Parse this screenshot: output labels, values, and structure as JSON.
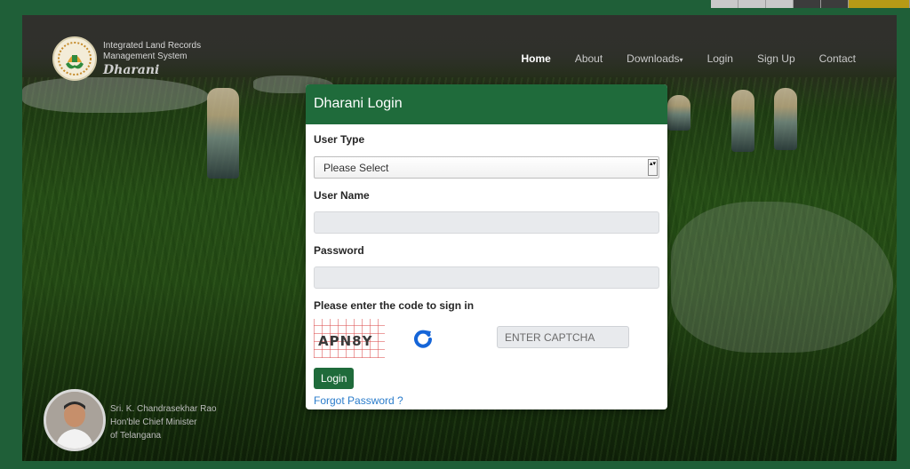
{
  "colors": {
    "brand_green": "#1f6b3b",
    "page_bg": "#1f5f38",
    "link_blue": "#2a7ccb",
    "input_bg": "#e8eaed"
  },
  "header": {
    "logo_icon": "dharani-logo-icon",
    "system_line1": "Integrated Land Records",
    "system_line2": "Management System",
    "brand_name": "Dharani"
  },
  "nav": {
    "items": [
      {
        "label": "Home",
        "active": true
      },
      {
        "label": "About",
        "active": false
      },
      {
        "label": "Downloads",
        "active": false,
        "dropdown": true
      },
      {
        "label": "Login",
        "active": false
      },
      {
        "label": "Sign Up",
        "active": false
      },
      {
        "label": "Contact",
        "active": false
      }
    ],
    "dropdown_caret": "▾"
  },
  "login": {
    "title": "Dharani Login",
    "user_type_label": "User Type",
    "user_type_selected": "Please Select",
    "select_arrow": "▴▾",
    "user_name_label": "User Name",
    "user_name_value": "",
    "password_label": "Password",
    "password_value": "",
    "captcha_label": "Please enter the code to sign in",
    "captcha_code": "APN8Y",
    "refresh_icon": "refresh-icon",
    "captcha_placeholder": "ENTER CAPTCHA",
    "login_button": "Login",
    "forgot_link": "Forgot Password ?"
  },
  "cm": {
    "name": "Sri. K. Chandrasekhar Rao",
    "title": "Hon'ble Chief Minister",
    "state": "of Telangana"
  }
}
